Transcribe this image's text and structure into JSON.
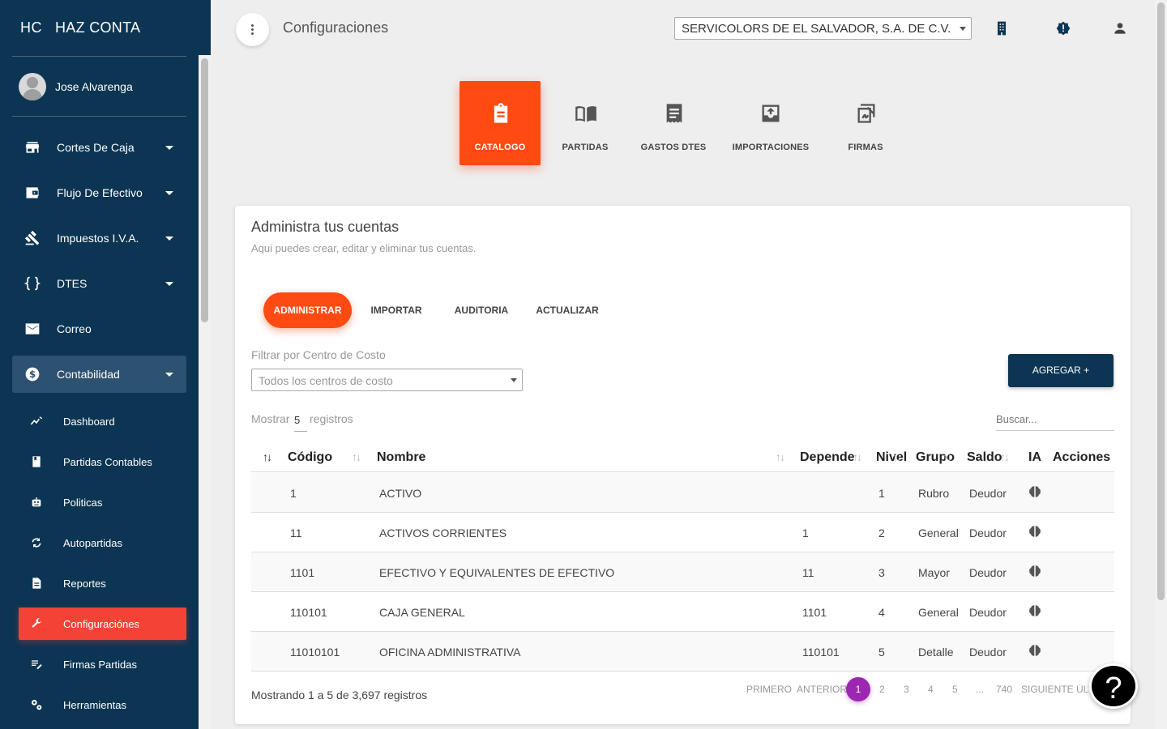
{
  "brand": {
    "mini": "HC",
    "name": "HAZ CONTA"
  },
  "user": {
    "name": "Jose Alvarenga"
  },
  "nav": [
    {
      "label": "Cortes De Caja",
      "icon": "store-icon"
    },
    {
      "label": "Flujo De Efectivo",
      "icon": "wallet-icon"
    },
    {
      "label": "Impuestos I.V.A.",
      "icon": "gavel-icon"
    },
    {
      "label": "DTES",
      "icon": "code-braces-icon"
    },
    {
      "label": "Correo",
      "icon": "mail-icon"
    },
    {
      "label": "Contabilidad",
      "icon": "dollar-circle-icon"
    }
  ],
  "subnav": [
    {
      "label": "Dashboard",
      "icon": "trending-icon"
    },
    {
      "label": "Partidas Contables",
      "icon": "book-icon"
    },
    {
      "label": "Politicas",
      "icon": "robot-icon"
    },
    {
      "label": "Autopartidas",
      "icon": "sync-icon"
    },
    {
      "label": "Reportes",
      "icon": "document-icon"
    },
    {
      "label": "Configuraciónes",
      "icon": "wrench-icon"
    },
    {
      "label": "Firmas Partidas",
      "icon": "edit-list-icon"
    },
    {
      "label": "Herramientas",
      "icon": "gears-icon"
    }
  ],
  "header": {
    "title": "Configuraciones",
    "company": "SERVICOLORS DE EL SALVADOR, S.A. DE C.V."
  },
  "tabs": [
    {
      "label": "CATALOGO",
      "icon": "clipboard-icon"
    },
    {
      "label": "PARTIDAS",
      "icon": "open-book-icon"
    },
    {
      "label": "GASTOS DTES",
      "icon": "receipt-icon"
    },
    {
      "label": "IMPORTACIONES",
      "icon": "upload-box-icon"
    },
    {
      "label": "FIRMAS",
      "icon": "signature-icon"
    }
  ],
  "card": {
    "title": "Administra tus cuentas",
    "subtitle": "Aqui puedes crear, editar y eliminar tus cuentas.",
    "pills": [
      "ADMINISTRAR",
      "IMPORTAR",
      "AUDITORIA",
      "ACTUALIZAR"
    ],
    "filter_label": "Filtrar por Centro de Costo",
    "filter_value": "Todos los centros de costo",
    "add_button": "AGREGAR +",
    "show_label": "Mostrar",
    "show_value": "5",
    "show_suffix": "registros",
    "search_placeholder": "Buscar..."
  },
  "table": {
    "headers": [
      "Código",
      "Nombre",
      "Depende",
      "Nivel",
      "Grupo",
      "Saldo",
      "IA",
      "Acciones"
    ],
    "rows": [
      {
        "codigo": "1",
        "nombre": "ACTIVO",
        "depende": "",
        "nivel": "1",
        "grupo": "Rubro",
        "saldo": "Deudor"
      },
      {
        "codigo": "11",
        "nombre": "ACTIVOS CORRIENTES",
        "depende": "1",
        "nivel": "2",
        "grupo": "General",
        "saldo": "Deudor"
      },
      {
        "codigo": "1101",
        "nombre": "EFECTIVO Y EQUIVALENTES DE EFECTIVO",
        "depende": "11",
        "nivel": "3",
        "grupo": "Mayor",
        "saldo": "Deudor"
      },
      {
        "codigo": "110101",
        "nombre": "CAJA GENERAL",
        "depende": "1101",
        "nivel": "4",
        "grupo": "General",
        "saldo": "Deudor"
      },
      {
        "codigo": "11010101",
        "nombre": "OFICINA ADMINISTRATIVA",
        "depende": "110101",
        "nivel": "5",
        "grupo": "Detalle",
        "saldo": "Deudor"
      }
    ]
  },
  "pagination": {
    "summary": "Mostrando 1 a 5 de 3,697 registros",
    "first": "PRIMERO",
    "prev": "ANTERIOR",
    "pages": [
      "1",
      "2",
      "3",
      "4",
      "5",
      "...",
      "740"
    ],
    "next": "SIGUIENTE",
    "last": "ÚLTIMO"
  },
  "help": "?",
  "colors": {
    "sidebar": "#0c3553",
    "accent": "#ff4a12",
    "active_sub": "#f44336",
    "page_current": "#9c27b0"
  }
}
